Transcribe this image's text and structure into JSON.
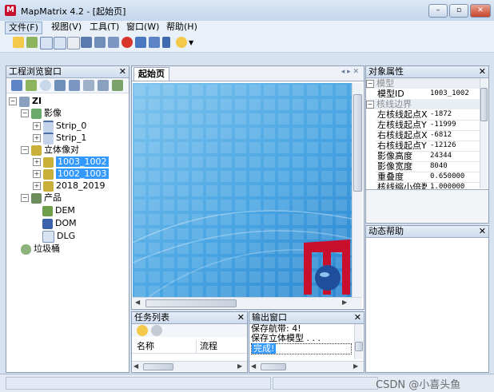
{
  "window": {
    "title": "MapMatrix 4.2 - [起始页]",
    "buttons": [
      "–",
      "▫",
      "✕"
    ]
  },
  "menu": [
    {
      "label": "文件(F)"
    },
    {
      "label": "视图(V)"
    },
    {
      "label": "工具(T)"
    },
    {
      "label": "窗口(W)"
    },
    {
      "label": "帮助(H)"
    }
  ],
  "toolbar_icons": [
    "new-icon",
    "open-icon",
    "select-icon",
    "frame-icon",
    "page-icon",
    "stereo-icon",
    "layer-icon",
    "transfer-icon",
    "stop-icon",
    "table-icon",
    "view-icon",
    "tool-icon",
    "help-icon",
    "dropdown-arrow-icon"
  ],
  "project_panel": {
    "title": "工程浏览窗口",
    "tree": {
      "root": "ZI",
      "imagery": {
        "label": "影像",
        "strips": [
          "Strip_0",
          "Strip_1"
        ]
      },
      "stereo": {
        "label": "立体像对",
        "items": [
          "1003_1002",
          "1002_1003",
          "2018_2019"
        ]
      },
      "products": {
        "label": "产品",
        "items": [
          "DEM",
          "DOM",
          "DLG"
        ]
      },
      "trash": "垃圾桶"
    }
  },
  "start_page": {
    "tab": "起始页"
  },
  "properties": {
    "title": "对象属性",
    "cat_model": "模型",
    "model_id_name": "模型ID",
    "model_id_val": "1003_1002",
    "cat_edge": "核线边界",
    "rows": [
      {
        "name": "左核线起点X",
        "value": "-1872"
      },
      {
        "name": "左核线起点Y",
        "value": "-11999"
      },
      {
        "name": "右核线起点X",
        "value": "-6812"
      },
      {
        "name": "右核线起点Y",
        "value": "-12126"
      },
      {
        "name": "影像高度",
        "value": "24344"
      },
      {
        "name": "影像宽度",
        "value": "8040"
      },
      {
        "name": "重叠度",
        "value": "0.650000"
      },
      {
        "name": "核线缩小倍数",
        "value": "1.000000"
      }
    ]
  },
  "dynamic_help": {
    "title": "动态帮助"
  },
  "task_list": {
    "title": "任务列表",
    "col_name": "名称",
    "col_process": "流程"
  },
  "output": {
    "title": "输出窗口",
    "lines": [
      "保存航带: 4!",
      "保存立体模型 . . .",
      "完成!"
    ]
  },
  "watermark": "CSDN @小喜头鱼",
  "colors": {
    "selection": "#3399ff",
    "brand": "#c8102e"
  }
}
